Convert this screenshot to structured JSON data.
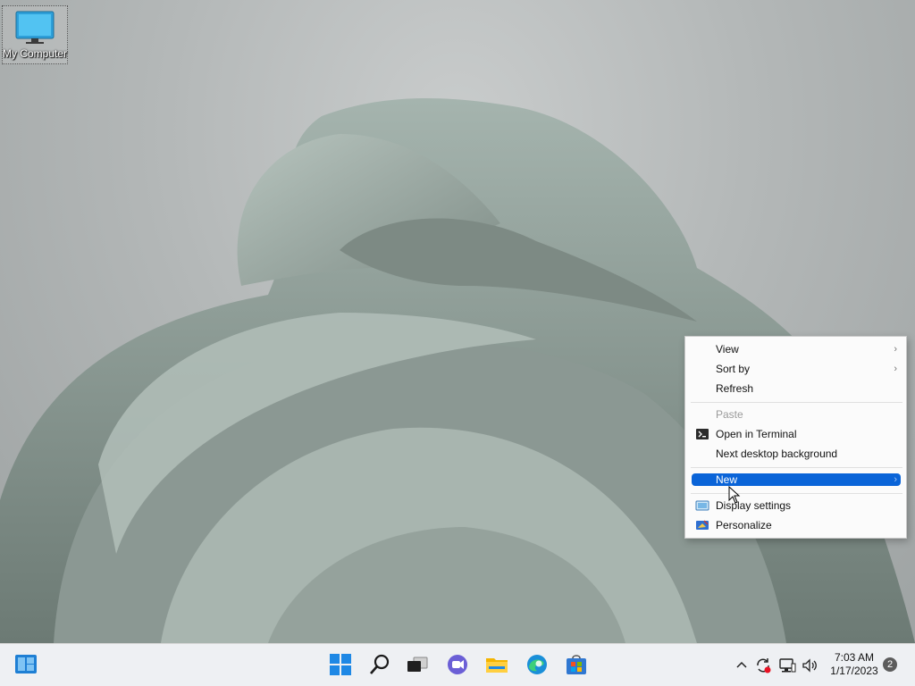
{
  "desktop": {
    "icons": [
      {
        "label": "My Computer",
        "icon": "monitor-icon"
      }
    ]
  },
  "context_menu": {
    "items": [
      {
        "label": "View",
        "submenu": true
      },
      {
        "label": "Sort by",
        "submenu": true
      },
      {
        "label": "Refresh"
      },
      {
        "label": "Paste",
        "disabled": true
      },
      {
        "label": "Open in Terminal",
        "icon": "terminal-icon"
      },
      {
        "label": "Next desktop background"
      },
      {
        "label": "New",
        "submenu": true,
        "highlighted": true
      },
      {
        "label": "Display settings",
        "icon": "display-settings-icon"
      },
      {
        "label": "Personalize",
        "icon": "personalize-icon"
      }
    ]
  },
  "taskbar": {
    "left": [
      {
        "icon": "widgets-icon"
      }
    ],
    "center": [
      {
        "icon": "start-icon"
      },
      {
        "icon": "search-icon"
      },
      {
        "icon": "task-view-icon"
      },
      {
        "icon": "chat-icon"
      },
      {
        "icon": "file-explorer-icon"
      },
      {
        "icon": "edge-icon"
      },
      {
        "icon": "store-icon"
      }
    ],
    "tray": [
      {
        "icon": "chevron-up-icon"
      },
      {
        "icon": "sync-alert-icon"
      },
      {
        "icon": "network-icon"
      },
      {
        "icon": "volume-icon"
      }
    ],
    "clock": {
      "time": "7:03 AM",
      "date": "1/17/2023"
    },
    "notification_count": "2"
  },
  "colors": {
    "accent": "#0a64d8",
    "taskbar_bg": "#eef0f3",
    "menu_bg": "#fbfbfb"
  }
}
